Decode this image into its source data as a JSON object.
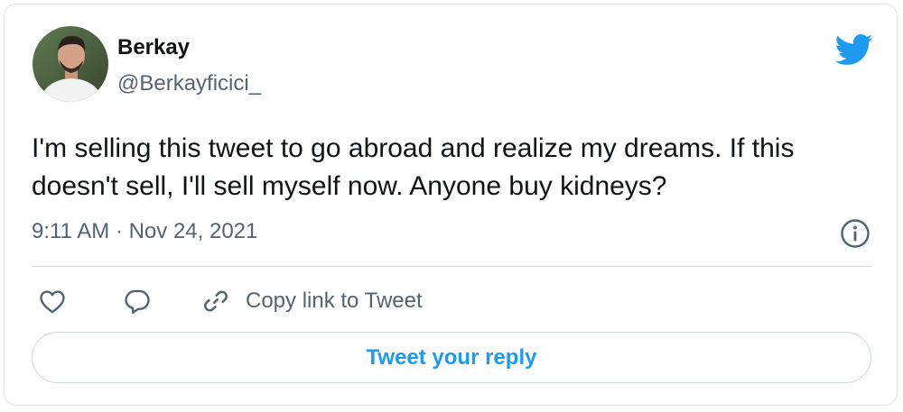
{
  "author": {
    "name": "Berkay",
    "handle": "@Berkayficici_"
  },
  "tweet": {
    "text": "I'm selling this tweet to go abroad and realize my dreams. If this doesn't sell, I'll sell myself now. Anyone buy kidneys?",
    "timestamp": "9:11 AM · Nov 24, 2021"
  },
  "actions": {
    "copy_link_label": "Copy link to Tweet",
    "reply_button_label": "Tweet your reply"
  },
  "icons": {
    "brand": "twitter-bird-icon",
    "info": "info-icon",
    "like": "heart-icon",
    "reply": "speech-bubble-icon",
    "copy": "link-icon"
  },
  "colors": {
    "brand_blue": "#1d9bf0",
    "text_primary": "#0f1419",
    "text_secondary": "#536471",
    "border": "#cfd9de"
  }
}
